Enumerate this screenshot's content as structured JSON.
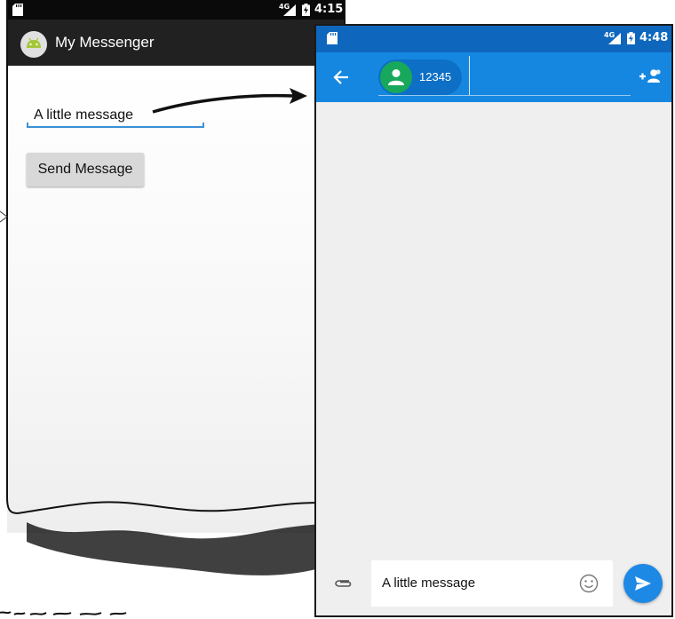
{
  "left_app": {
    "status_time": "4:15",
    "network": "4G",
    "title": "My Messenger",
    "message_value": "A little message",
    "send_button_label": "Send Message"
  },
  "right_app": {
    "status_time": "4:48",
    "network": "4G",
    "recipient": "12345",
    "compose_value": "A little message"
  },
  "icons": {
    "left": [
      "sd-card-icon",
      "signal-icon",
      "battery-icon",
      "android-icon"
    ],
    "right": [
      "sd-card-icon",
      "signal-icon",
      "battery-icon",
      "back-arrow-icon",
      "person-icon",
      "add-people-icon",
      "attach-icon",
      "emoji-icon",
      "send-icon"
    ]
  },
  "colors": {
    "left_appbar": "#212121",
    "android_green": "#a4c639",
    "right_status": "#0e67bd",
    "right_toolbar": "#1587e0",
    "chip_green": "#18a85b",
    "chip_bg": "#0d6fc6",
    "send_fab": "#1e88e5",
    "input_underline": "#3b8fd6"
  }
}
